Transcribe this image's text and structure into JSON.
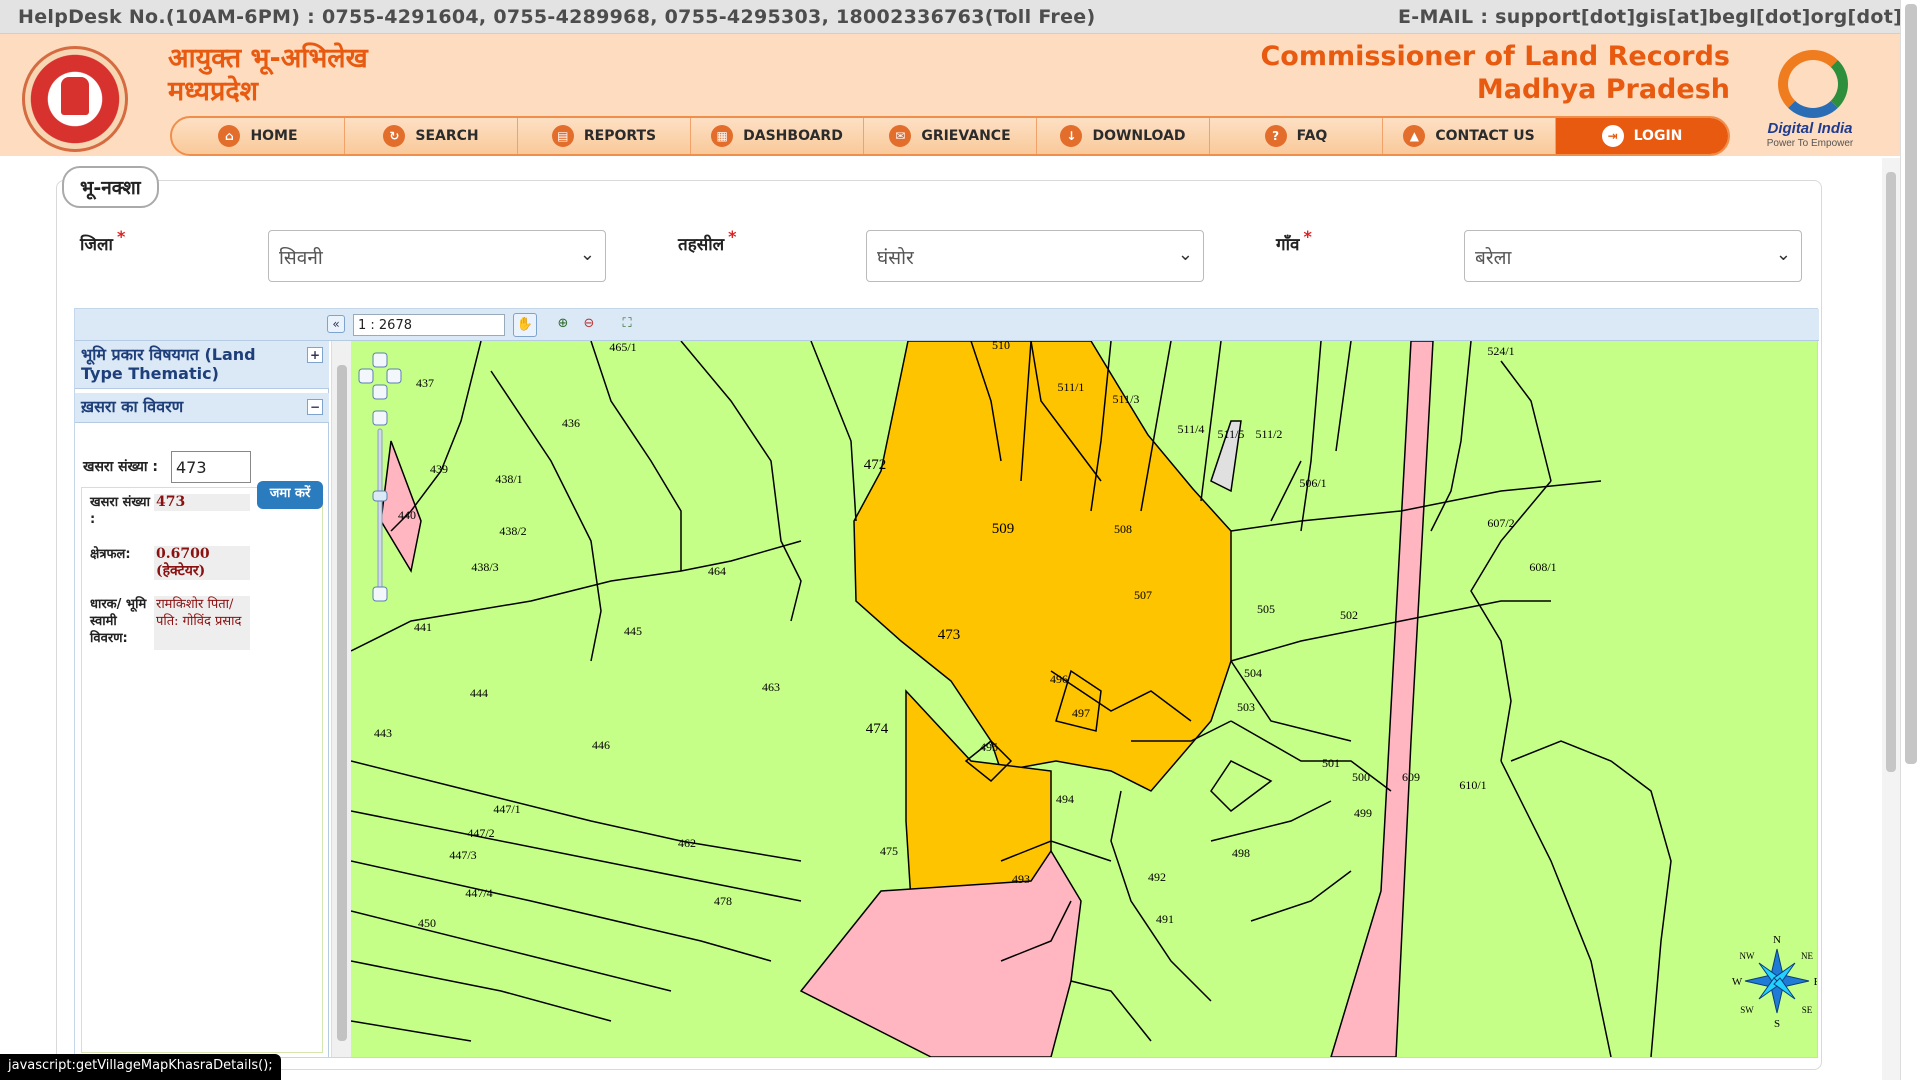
{
  "helpdesk": "HelpDesk No.(10AM-6PM) : 0755-4291604, 0755-4289968, 0755-4295303, 18002336763(Toll Free)",
  "email": "E-MAIL : support[dot]gis[at]begl[dot]org[dot]in",
  "header": {
    "hi_title_1": "आयुक्त भू-अभिलेख",
    "hi_title_2": "मध्यप्रदेश",
    "en_title_1": "Commissioner of Land Records",
    "en_title_2": "Madhya Pradesh",
    "digital_india": "Digital India",
    "digital_india_tag": "Power To Empower"
  },
  "nav": [
    {
      "label": "HOME",
      "icon": "home-icon"
    },
    {
      "label": "SEARCH",
      "icon": "search-icon"
    },
    {
      "label": "REPORTS",
      "icon": "report-icon"
    },
    {
      "label": "DASHBOARD",
      "icon": "dashboard-icon"
    },
    {
      "label": "GRIEVANCE",
      "icon": "grievance-icon"
    },
    {
      "label": "DOWNLOAD",
      "icon": "download-icon"
    },
    {
      "label": "FAQ",
      "icon": "faq-icon"
    },
    {
      "label": "CONTACT US",
      "icon": "contact-icon"
    },
    {
      "label": "LOGIN",
      "icon": "login-icon"
    }
  ],
  "page_tab": "भू-नक्शा",
  "filters": {
    "district": {
      "label": "जिला",
      "value": "सिवनी"
    },
    "tehsil": {
      "label": "तहसील",
      "value": "घंसोर"
    },
    "village": {
      "label": "गाँव",
      "value": "बरेला"
    },
    "required_mark": "*"
  },
  "toolbar": {
    "scale": "1 : 2678",
    "collapse": "«"
  },
  "panel": {
    "land_type": "भूमि प्रकार विषयगत (Land Type Thematic)",
    "khasra_details": "ख़सरा का विवरण",
    "khasra_no_label": "खसरा संख्या :",
    "khasra_no_value": "473",
    "submit": "जमा करें",
    "details": {
      "khasra_label": "खसरा संख्या :",
      "khasra_value": "473",
      "area_label": "क्षेत्रफल:",
      "area_value": "0.6700 (हेक्टेयर)",
      "owner_label": "धारक/ भूमि स्वामी विवरण:",
      "owner_value": "रामकिशोर पिता/पति: गोविंद प्रसाद"
    }
  },
  "map": {
    "colors": {
      "land": "#c6ff88",
      "selected": "#ffc400",
      "pink": "#ffb6c1",
      "grey": "#e0e0e0",
      "border": "#000000"
    },
    "parcels": [
      "465/1",
      "510",
      "511/1",
      "511/3",
      "511/4",
      "511/5",
      "511/2",
      "524/1",
      "437",
      "436",
      "439",
      "438/1",
      "438/2",
      "440",
      "438/3",
      "472",
      "509",
      "508",
      "506/1",
      "607/2",
      "608/1",
      "464",
      "507",
      "505",
      "502",
      "441",
      "445",
      "473",
      "504",
      "463",
      "444",
      "496",
      "497",
      "503",
      "474",
      "443",
      "446",
      "495",
      "501",
      "500",
      "609",
      "610/1",
      "447/1",
      "494",
      "499",
      "447/2",
      "447/3",
      "462",
      "475",
      "498",
      "447/4",
      "493",
      "492",
      "478",
      "450",
      "491"
    ],
    "compass": {
      "n": "N",
      "ne": "NE",
      "e": "E",
      "se": "SE",
      "s": "S",
      "sw": "SW",
      "w": "W",
      "nw": "NW"
    }
  },
  "status_bar": "javascript:getVillageMapKhasraDetails();"
}
